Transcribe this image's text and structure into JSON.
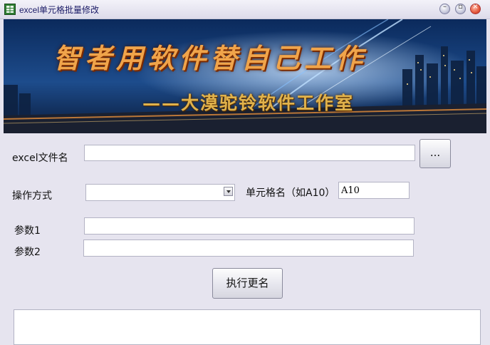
{
  "window": {
    "title": "excel单元格批量修改",
    "minimize_icon": "minimize-icon",
    "maximize_icon": "maximize-icon",
    "close_icon": "close-icon"
  },
  "banner": {
    "slogan": "智者用软件替自己工作",
    "subslogan": "——大漠驼铃软件工作室"
  },
  "form": {
    "file_label": "excel文件名",
    "file_value": "",
    "browse_label": "...",
    "operation_label": "操作方式",
    "operation_value": "",
    "cell_label": "单元格名（如A10）",
    "cell_value": "A10",
    "param1_label": "参数1",
    "param1_value": "",
    "param2_label": "参数2",
    "param2_value": "",
    "execute_label": "执行更名"
  },
  "output": {
    "text": ""
  },
  "colors": {
    "accent": "#1a1a66",
    "banner_text": "#f0a44a",
    "close": "#e4593c"
  }
}
